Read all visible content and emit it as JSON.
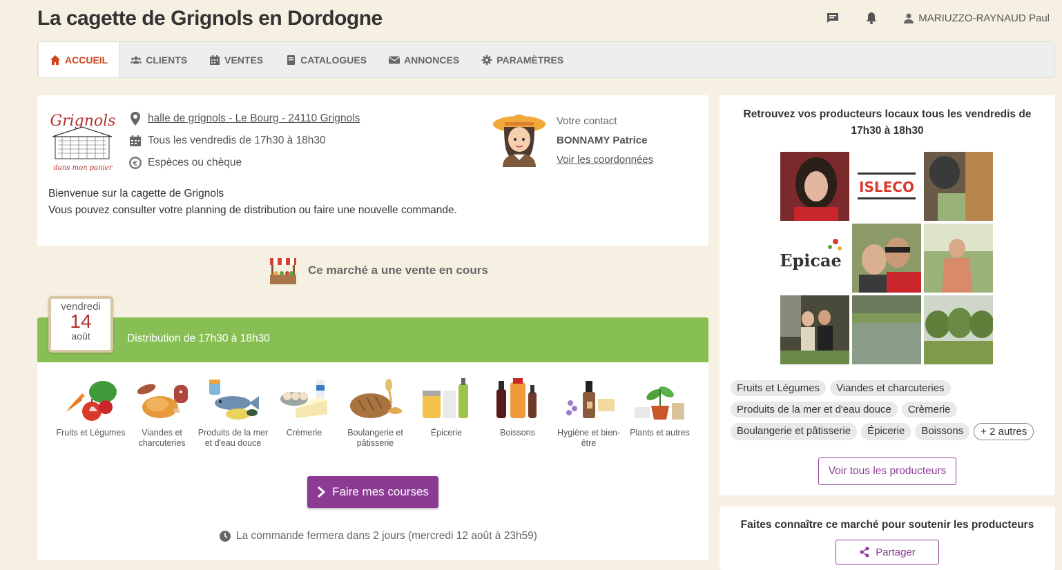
{
  "header": {
    "title": "La cagette de Grignols en Dordogne",
    "user_name": "MARIUZZO-RAYNAUD Paul"
  },
  "nav": {
    "items": [
      {
        "label": "ACCUEIL",
        "icon": "home-icon"
      },
      {
        "label": "CLIENTS",
        "icon": "users-icon"
      },
      {
        "label": "VENTES",
        "icon": "calendar-icon"
      },
      {
        "label": "CATALOGUES",
        "icon": "book-icon"
      },
      {
        "label": "ANNONCES",
        "icon": "envelope-icon"
      },
      {
        "label": "PARAMÈTRES",
        "icon": "gear-icon"
      }
    ],
    "active": "ACCUEIL"
  },
  "market": {
    "logo_text": "Grignols",
    "logo_subtext": "dans mon panier",
    "address": "halle de grignols - Le Bourg - 24110 Grignols",
    "schedule": "Tous les vendredis de 17h30 à 18h30",
    "payment": "Espèces ou chèque",
    "contact_label": "Votre contact",
    "contact_name": "BONNAMY Patrice",
    "contact_link": "Voir les coordonnées",
    "welcome_line1": "Bienvenue sur la cagette de Grignols",
    "welcome_line2": "Vous pouvez consulter votre planning de distribution ou faire une nouvelle commande."
  },
  "sale": {
    "ongoing_text": "Ce marché a une vente en cours",
    "day_name": "vendredi",
    "day_number": "14",
    "month": "août",
    "distribution": "Distribution de 17h30 à 18h30",
    "categories": [
      {
        "label": "Fruits et Légumes"
      },
      {
        "label": "Viandes et charcuteries"
      },
      {
        "label": "Produits de la mer et d'eau douce"
      },
      {
        "label": "Crèmerie"
      },
      {
        "label": "Boulangerie et pâtisserie"
      },
      {
        "label": "Épicerie"
      },
      {
        "label": "Boissons"
      },
      {
        "label": "Hygiène et bien-être"
      },
      {
        "label": "Plants et autres"
      }
    ],
    "shop_button": "Faire mes courses",
    "close_note": "La commande fermera dans 2 jours (mercredi 12 août à 23h59)"
  },
  "producers": {
    "title": "Retrouvez vos producteurs locaux tous les vendredis de 17h30 à 18h30",
    "logo_isleco": "ISLECO",
    "logo_epicae": "Epicae",
    "tags": [
      "Fruits et Légumes",
      "Viandes et charcuteries",
      "Produits de la mer et d'eau douce",
      "Crèmerie",
      "Boulangerie et pâtisserie",
      "Épicerie",
      "Boissons",
      "+ 2 autres"
    ],
    "all_button": "Voir tous les producteurs"
  },
  "share": {
    "title": "Faites connaître ce marché pour soutenir les producteurs",
    "button": "Partager"
  },
  "colors": {
    "accent_purple": "#8c3b94",
    "green": "#88bf55",
    "active_orange": "#d2441e",
    "background": "#f5f0e1"
  }
}
